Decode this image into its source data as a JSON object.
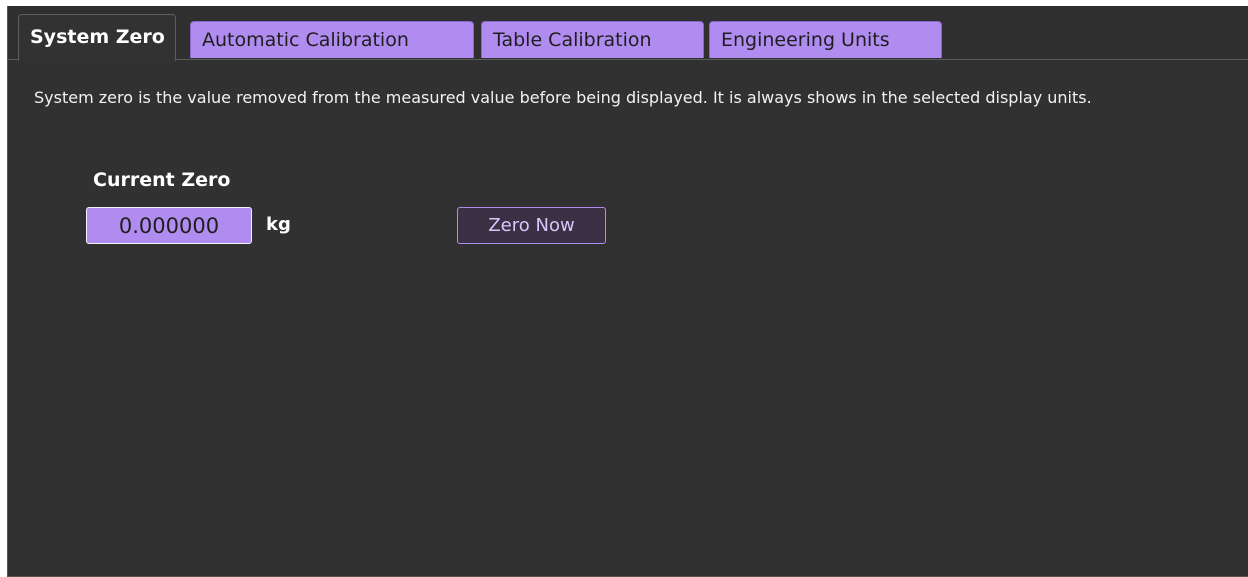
{
  "tabs": [
    {
      "label": "System Zero",
      "active": true
    },
    {
      "label": "Automatic Calibration",
      "active": false
    },
    {
      "label": "Table Calibration",
      "active": false
    },
    {
      "label": "Engineering Units",
      "active": false
    }
  ],
  "panel": {
    "description": "System zero is the value removed from the measured value before being displayed. It is always shows in the selected display units.",
    "current_zero_label": "Current Zero",
    "current_zero_value": "0.000000",
    "unit": "kg",
    "zero_now_label": "Zero Now"
  },
  "colors": {
    "accent": "#b18cf0",
    "panel_bg": "#313131",
    "text": "#ffffff"
  }
}
